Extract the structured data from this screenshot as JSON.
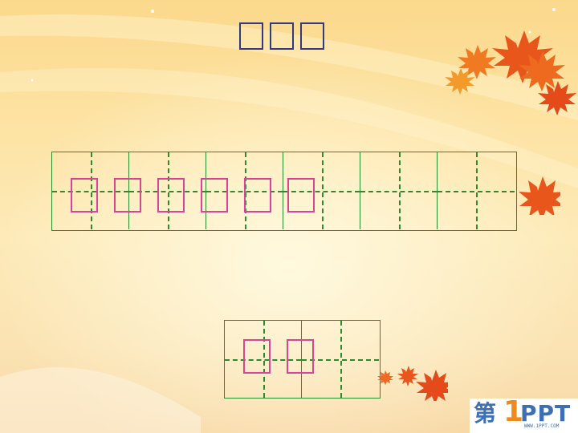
{
  "title": {
    "glyph_count": 3,
    "color": "#303a7c"
  },
  "top_grid": {
    "cells": 6,
    "line_color": "#2f8a2f",
    "glyph_count": 6
  },
  "bottom_grid": {
    "cells": 2,
    "line_color": "#2f8a2f",
    "glyph_count": 2
  },
  "glyph_color": "#d8449a",
  "logo": {
    "char_1": "第",
    "char_2": "1",
    "char_3": "PPT",
    "sub": "WWW.1PPT.COM"
  },
  "decor": {
    "icons": [
      "maple-leaf-icon"
    ]
  }
}
